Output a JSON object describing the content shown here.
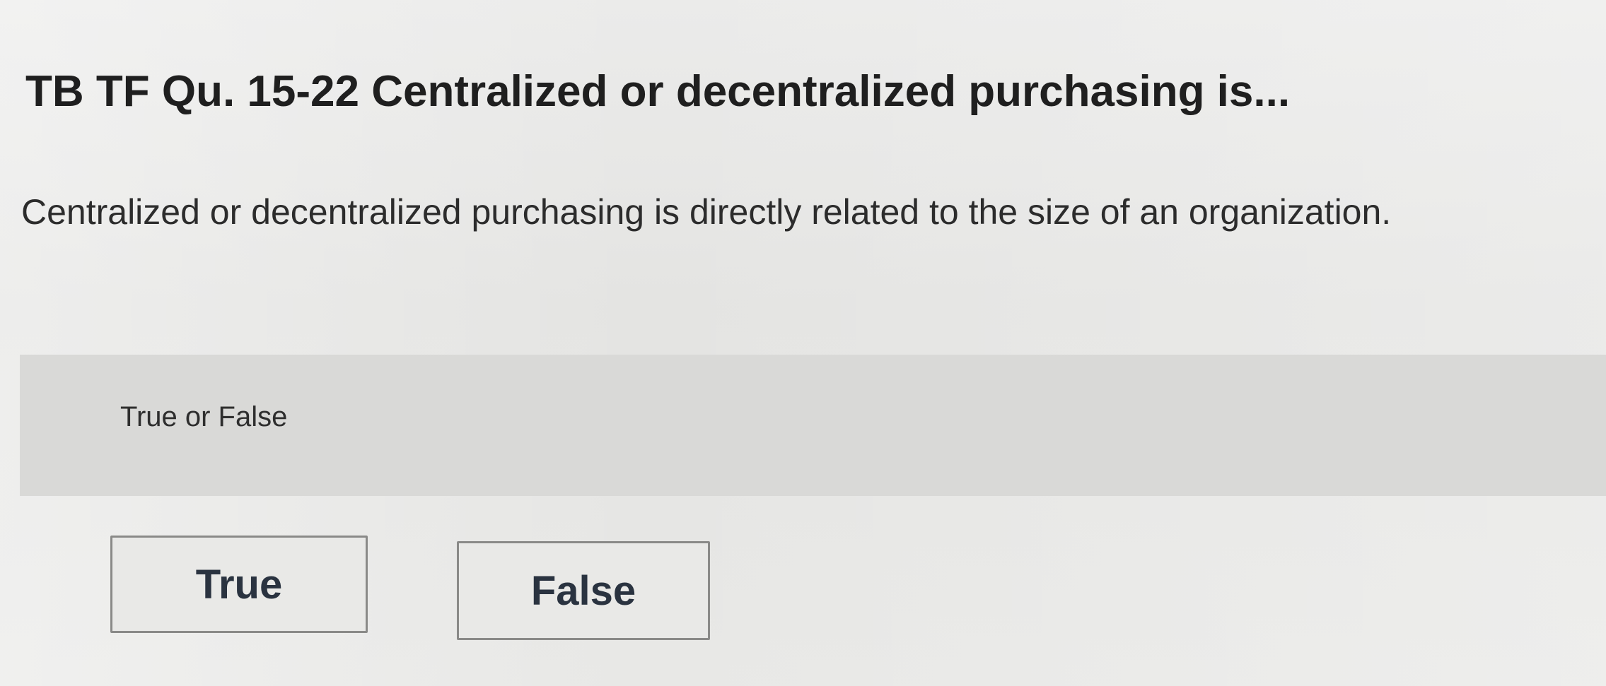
{
  "question": {
    "title": "TB TF Qu. 15-22 Centralized or decentralized purchasing is...",
    "text": "Centralized or decentralized purchasing is directly related to the size of an organization."
  },
  "answer": {
    "type_label": "True or False",
    "options": [
      {
        "label": "True"
      },
      {
        "label": "False"
      }
    ]
  }
}
